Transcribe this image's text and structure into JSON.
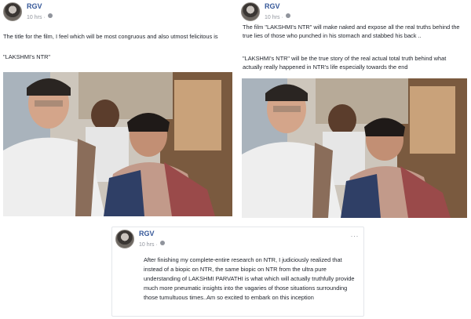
{
  "posts": [
    {
      "author": "RGV",
      "time": "10 hrs ·",
      "paragraphs": [
        "The title for the film, I feel which will be most congruous and also utmost felicitous is",
        "\"LAKSHMI's NTR\""
      ]
    },
    {
      "author": "RGV",
      "time": "10 hrs ·",
      "paragraphs": [
        "The film \"LAKSHMI's NTR\" will make naked and expose all the real truths behind the true lies of those who punched in his stomach and stabbed his back ..",
        "\"LAKSHMI's NTR\" will be the true story of the real actual total truth behind what actually really happened in NTR's life especially towards the end"
      ]
    },
    {
      "author": "RGV",
      "time": "10 hrs ·",
      "more": "···",
      "paragraphs": [
        "After finishing my complete-entire research on NTR, I judiciously realized that instead of a biopic on NTR, the same biopic on NTR from the ultra pure understanding of LAKSHMI PARVATHI is what which will actually truthfully provide much more pneumatic insights into the vagaries of those situations surrounding those tumultuous times..Am so excited to embark on this inception"
      ]
    }
  ]
}
